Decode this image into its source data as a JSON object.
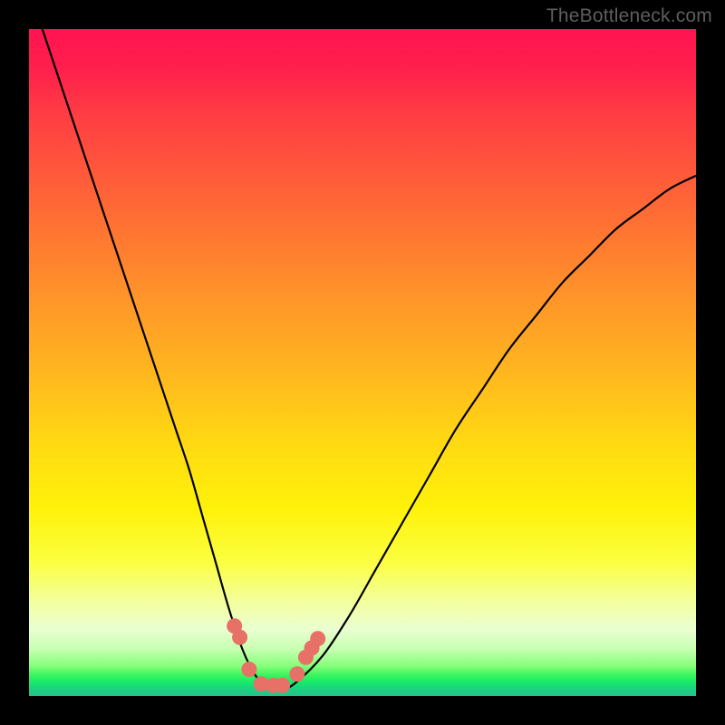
{
  "watermark": "TheBottleneck.com",
  "colors": {
    "frame": "#000000",
    "curve_stroke": "#000000",
    "marker_fill": "#e77067",
    "marker_stroke": "#c95a54"
  },
  "chart_data": {
    "type": "line",
    "title": "",
    "xlabel": "",
    "ylabel": "",
    "xlim": [
      0,
      100
    ],
    "ylim": [
      0,
      100
    ],
    "grid": false,
    "x": [
      0,
      2,
      4,
      6,
      8,
      10,
      12,
      14,
      16,
      18,
      20,
      22,
      24,
      26,
      28,
      30,
      32,
      34,
      36,
      38,
      40,
      44,
      48,
      52,
      56,
      60,
      64,
      68,
      72,
      76,
      80,
      84,
      88,
      92,
      96,
      100
    ],
    "values": [
      106,
      100,
      94,
      88,
      82,
      76,
      70,
      64,
      58,
      52,
      46,
      40,
      34,
      27,
      20,
      13,
      7,
      3,
      1,
      1,
      2,
      6,
      12,
      19,
      26,
      33,
      40,
      46,
      52,
      57,
      62,
      66,
      70,
      73,
      76,
      78
    ],
    "markers": {
      "x": [
        30.8,
        31.6,
        33.0,
        34.8,
        36.6,
        38.0,
        40.2,
        41.5,
        42.4,
        43.3
      ],
      "y": [
        10.5,
        8.8,
        4.0,
        1.8,
        1.6,
        1.6,
        3.3,
        5.8,
        7.2,
        8.6
      ]
    },
    "annotations": []
  }
}
